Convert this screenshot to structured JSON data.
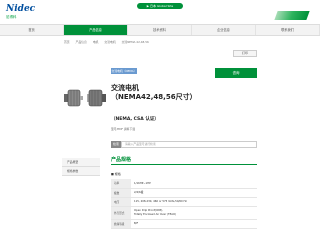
{
  "brand": {
    "name": "Nidec",
    "sub": "尼得科"
  },
  "header": {
    "pill_text": "▶ 日本 Global Site"
  },
  "nav": {
    "items": [
      {
        "label": "首页",
        "active": false
      },
      {
        "label": "产品信息",
        "active": true
      },
      {
        "label": "技术资料",
        "active": false
      },
      {
        "label": "企业信息",
        "active": false
      },
      {
        "label": "联系我们",
        "active": false
      }
    ]
  },
  "breadcrumb": [
    "首页",
    "产品信息",
    "电机",
    "交流电机",
    "交流NEMA 42,48,56"
  ],
  "toolbar": {
    "print_label": "打印"
  },
  "product": {
    "category_tag": "交流电机（NEMA）",
    "title_line1": "交流电机",
    "title_line2": "（NEMA42,48,56尺寸）",
    "cta_label": "咨询",
    "cert": "（NEMA, CSA 认证）",
    "note": "型号/PDF 资料下载"
  },
  "search": {
    "label": "检索",
    "placeholder": "请输入产品型号进行检索"
  },
  "sidebar": {
    "items": [
      "产品概要",
      "规格参数"
    ]
  },
  "specs": {
    "section_title": "产品规格",
    "sub_title": "■ 规格",
    "rows": [
      {
        "key": "功率",
        "value": "1/16HP~1HP"
      },
      {
        "key": "极数",
        "value": "2/4/6极"
      },
      {
        "key": "电压",
        "value": "115, 208-230, 460 or 575 Volts,50/60 Hz"
      },
      {
        "key": "外壳形式",
        "value": "Open Drip Proof(ODP),\nTotally Enclosed Air Over (TEAO)"
      },
      {
        "key": "绝缘等级",
        "value": "B/F"
      }
    ]
  },
  "colors": {
    "brand_green": "#00913a",
    "brand_blue": "#004f9f",
    "tag_blue": "#6a9ad0"
  }
}
